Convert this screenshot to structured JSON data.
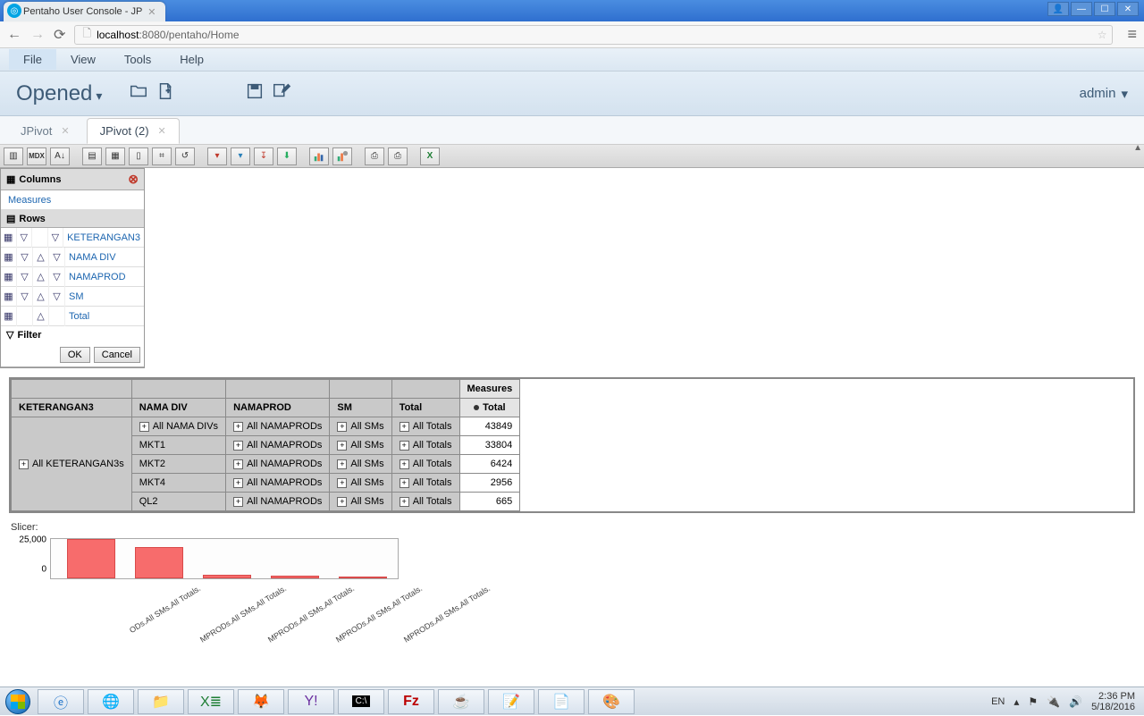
{
  "browser": {
    "tab_title": "Pentaho User Console - JP",
    "url_host": "localhost",
    "url_port_path": ":8080/pentaho/Home"
  },
  "menu": {
    "file": "File",
    "view": "View",
    "tools": "Tools",
    "help": "Help"
  },
  "topbar": {
    "opened": "Opened",
    "user": "admin"
  },
  "tabs": {
    "t1": "JPivot",
    "t2": "JPivot (2)"
  },
  "navigator": {
    "columns_title": "Columns",
    "measures": "Measures",
    "rows_title": "Rows",
    "rows": [
      "KETERANGAN3",
      "NAMA DIV",
      "NAMAPROD",
      "SM",
      "Total"
    ],
    "filter_title": "Filter",
    "ok": "OK",
    "cancel": "Cancel"
  },
  "pivot": {
    "meas_header": "Measures",
    "total_header": "Total",
    "col_headers": [
      "KETERANGAN3",
      "NAMA DIV",
      "NAMAPROD",
      "SM",
      "Total"
    ],
    "rows": [
      {
        "k": "All KETERANGAN3s",
        "d": "All NAMA DIVs",
        "p": "All NAMAPRODs",
        "s": "All SMs",
        "t": "All Totals",
        "v": "43849"
      },
      {
        "k": "",
        "d": "MKT1",
        "p": "All NAMAPRODs",
        "s": "All SMs",
        "t": "All Totals",
        "v": "33804"
      },
      {
        "k": "",
        "d": "MKT2",
        "p": "All NAMAPRODs",
        "s": "All SMs",
        "t": "All Totals",
        "v": "6424"
      },
      {
        "k": "",
        "d": "MKT4",
        "p": "All NAMAPRODs",
        "s": "All SMs",
        "t": "All Totals",
        "v": "2956"
      },
      {
        "k": "",
        "d": "QL2",
        "p": "All NAMAPRODs",
        "s": "All SMs",
        "t": "All Totals",
        "v": "665"
      }
    ]
  },
  "slicer_label": "Slicer:",
  "chart_data": {
    "type": "bar",
    "ylabel": "",
    "yticks": [
      0,
      25000
    ],
    "ylim": [
      0,
      35000
    ],
    "categories": [
      "ODs.All SMs.All Totals.",
      "MPRODs.All SMs.All Totals.",
      "MPRODs.All SMs.All Totals.",
      "MPRODs.All SMs.All Totals.",
      "MPRODs.All SMs.All Totals."
    ],
    "values": [
      33804,
      27000,
      3000,
      2000,
      665
    ]
  },
  "tray": {
    "lang": "EN",
    "time": "2:36 PM",
    "date": "5/18/2016"
  }
}
